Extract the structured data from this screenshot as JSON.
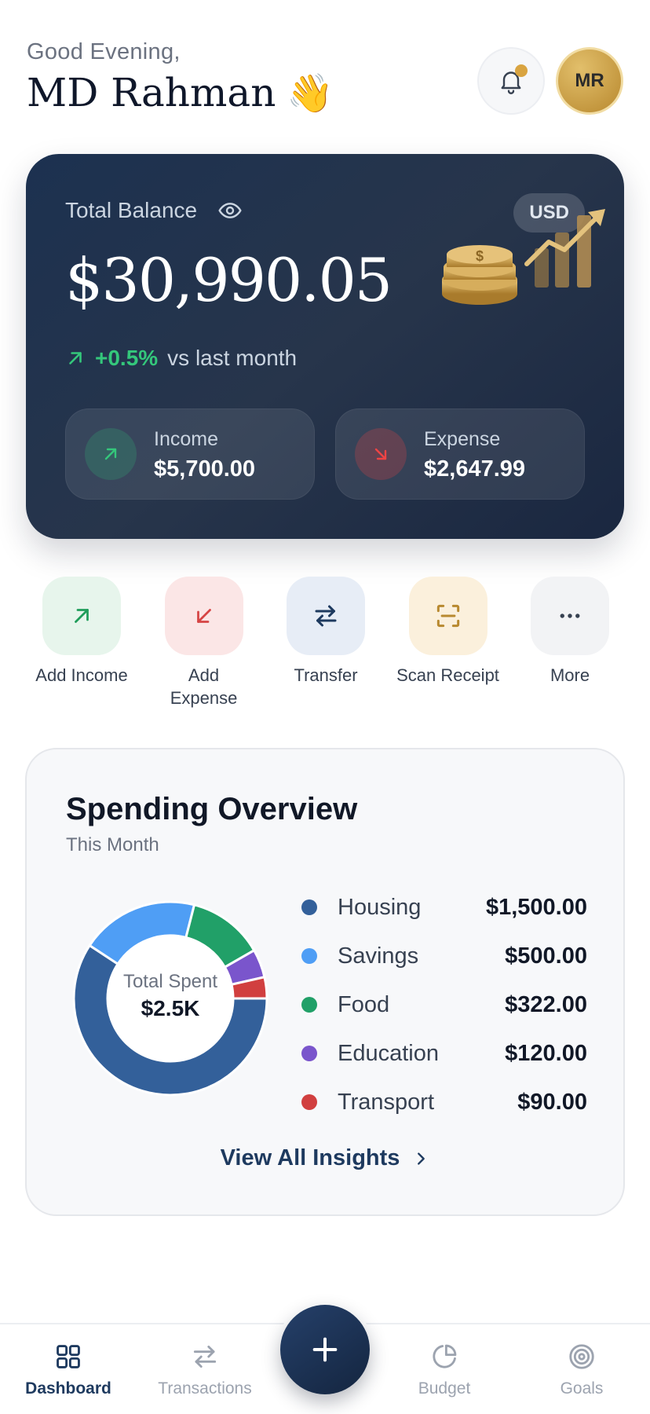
{
  "header": {
    "greeting": "Good Evening,",
    "user_name": "MD Rahman",
    "wave_emoji": "👋",
    "avatar_initials": "MR",
    "notification_icon": "bell-icon"
  },
  "balance": {
    "label": "Total Balance",
    "currency": "USD",
    "amount": "$30,990.05",
    "change_percent": "+0.5%",
    "change_text": "vs last month",
    "income": {
      "label": "Income",
      "value": "$5,700.00"
    },
    "expense": {
      "label": "Expense",
      "value": "$2,647.99"
    },
    "colors": {
      "positive": "#34c77b",
      "negative": "#ef4444"
    }
  },
  "quick_actions": [
    {
      "label": "Add Income",
      "icon": "arrow-up-right-icon",
      "bg": "#e7f5ec",
      "color": "#1f9d5a"
    },
    {
      "label": "Add Expense",
      "icon": "arrow-down-left-icon",
      "bg": "#fbe6e6",
      "color": "#d64545"
    },
    {
      "label": "Transfer",
      "icon": "swap-arrows-icon",
      "bg": "#e7edf6",
      "color": "#1e3a5f"
    },
    {
      "label": "Scan Receipt",
      "icon": "scan-icon",
      "bg": "#fbf0dc",
      "color": "#b8892f"
    },
    {
      "label": "More",
      "icon": "more-dots-icon",
      "bg": "#f2f3f5",
      "color": "#374151"
    }
  ],
  "spending": {
    "title": "Spending Overview",
    "subtitle": "This Month",
    "total_label": "Total Spent",
    "total_value": "$2.5K",
    "view_all": "View All Insights",
    "categories": [
      {
        "name": "Housing",
        "amount": "$1,500.00",
        "value": 1500,
        "color": "#33609a"
      },
      {
        "name": "Savings",
        "amount": "$500.00",
        "value": 500,
        "color": "#4f9ef5"
      },
      {
        "name": "Food",
        "amount": "$322.00",
        "value": 322,
        "color": "#21a068"
      },
      {
        "name": "Education",
        "amount": "$120.00",
        "value": 120,
        "color": "#7a55cc"
      },
      {
        "name": "Transport",
        "amount": "$90.00",
        "value": 90,
        "color": "#d13f3f"
      }
    ]
  },
  "bottom_nav": {
    "items": [
      {
        "label": "Dashboard",
        "icon": "grid-icon",
        "active": true
      },
      {
        "label": "Transactions",
        "icon": "swap-arrows-icon",
        "active": false
      },
      {
        "label": "Budget",
        "icon": "pie-chart-icon",
        "active": false
      },
      {
        "label": "Goals",
        "icon": "target-icon",
        "active": false
      }
    ],
    "fab_icon": "plus-icon"
  }
}
